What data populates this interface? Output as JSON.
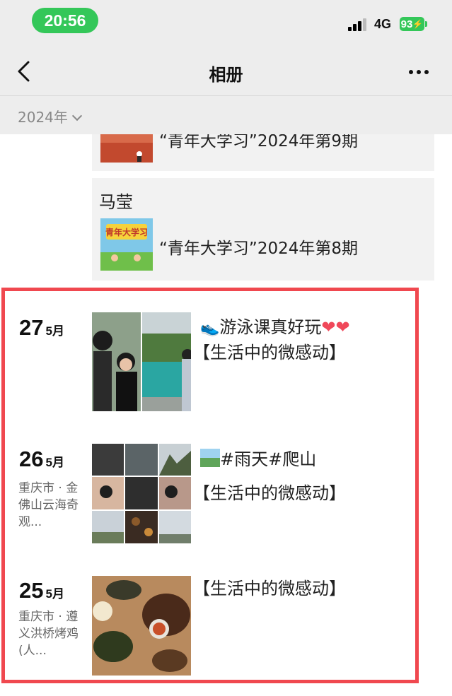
{
  "status_bar": {
    "time": "20:56",
    "network": "4G",
    "battery": "93"
  },
  "nav": {
    "title": "相册"
  },
  "year_selector": {
    "label": "2024年"
  },
  "shared_posts": [
    {
      "author": "",
      "caption": "“青年大学习”2024年第9期"
    },
    {
      "author": "马莹",
      "caption": "“青年大学习”2024年第8期"
    }
  ],
  "entries": [
    {
      "day": "27",
      "month": "5月",
      "location": "",
      "caption_line1": "游泳课真好玩",
      "caption_line2": "【生活中的微感动】",
      "photo_count": 2
    },
    {
      "day": "26",
      "month": "5月",
      "location": "重庆市 · 金佛山云海奇观...",
      "caption_line1": "#雨天#爬山",
      "caption_line2": "【生活中的微感动】",
      "photo_count": 9
    },
    {
      "day": "25",
      "month": "5月",
      "location": "重庆市 · 遵义洪桥烤鸡 (人...",
      "caption_line1": "【生活中的微感动】",
      "caption_line2": "",
      "photo_count": 1
    }
  ],
  "colors": {
    "highlight_border": "#f0484f",
    "status_green": "#34c759",
    "card_bg": "#f2f2f2"
  },
  "icons": [
    "back-chevron-icon",
    "more-dots-icon",
    "chevron-down-icon",
    "signal-icon",
    "battery-icon",
    "sneaker-emoji-icon",
    "heart-icon",
    "mountain-emoji-icon"
  ]
}
